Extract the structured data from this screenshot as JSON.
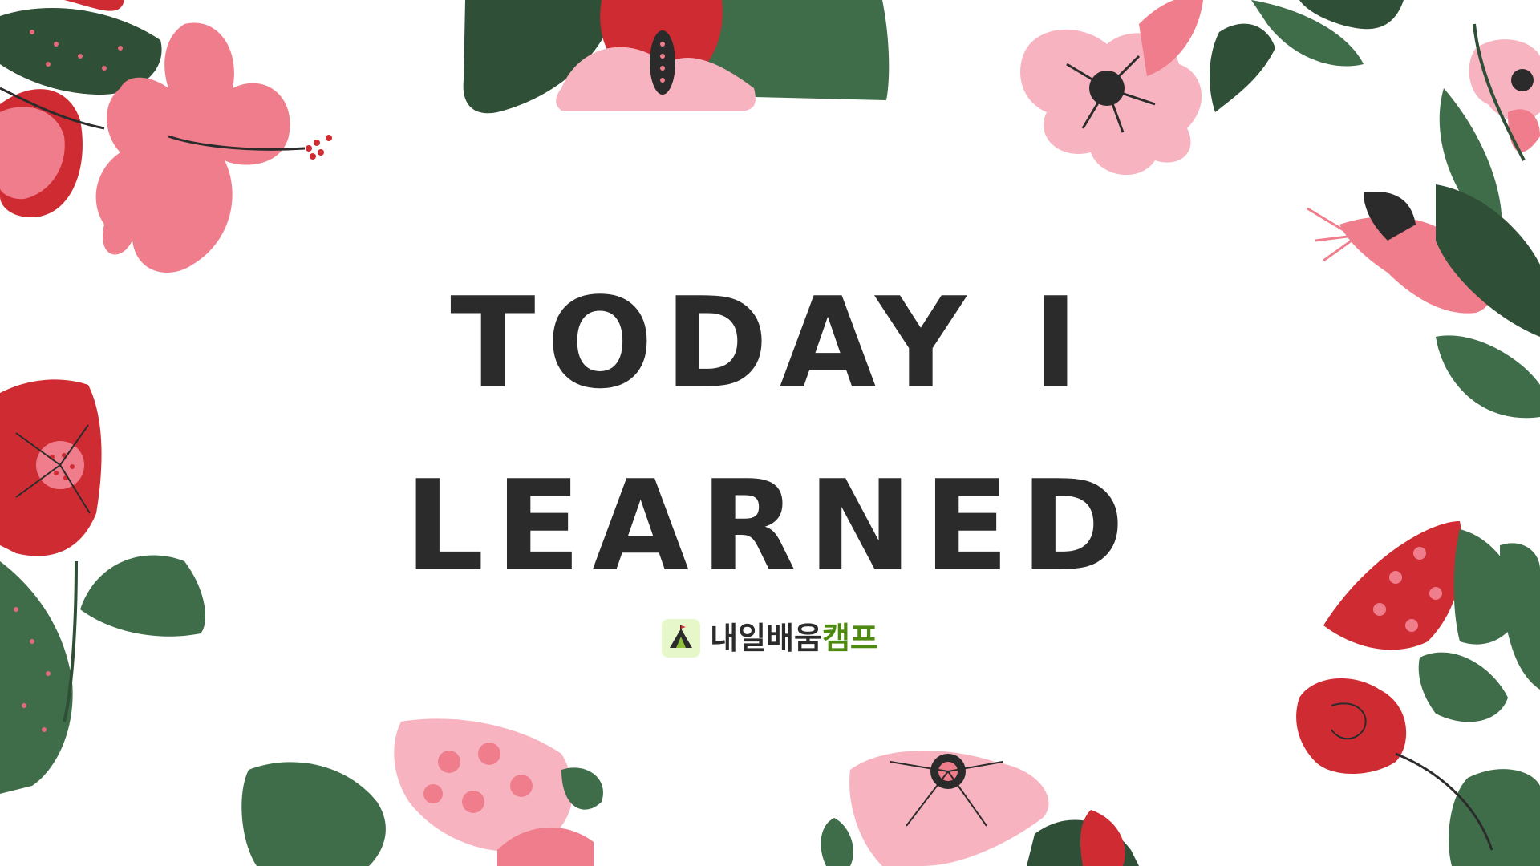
{
  "title": {
    "line1": "TODAY I",
    "line2": "LEARNED"
  },
  "brand": {
    "name_dark": "내일배움",
    "name_green": "캠프",
    "logo_icon": "tent-icon"
  },
  "colors": {
    "background": "#ffffff",
    "title_text": "#2b2b2b",
    "brand_dark": "#2b2b2b",
    "brand_green": "#4f8a10",
    "brand_logo_bg": "#e6f7c9",
    "leaf_dark": "#2f4f37",
    "leaf_green": "#3f6d4a",
    "flower_pink": "#f07d8c",
    "flower_light_pink": "#f7b4c0",
    "flower_red": "#cf2b33"
  }
}
